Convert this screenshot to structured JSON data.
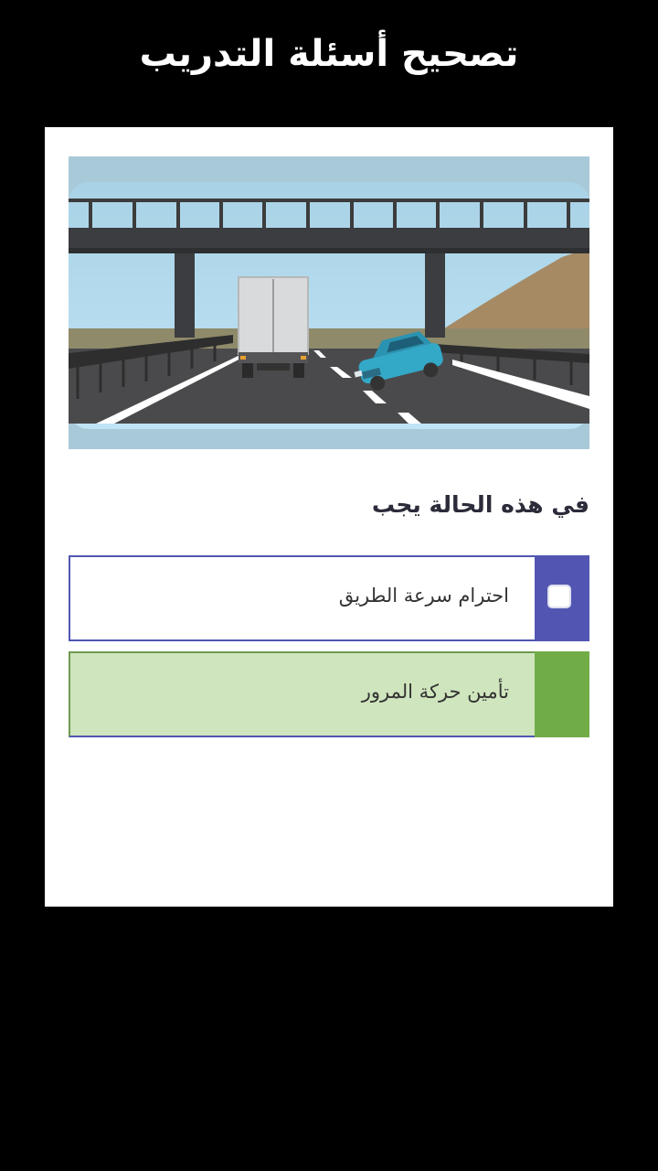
{
  "header": {
    "title": "تصحيح أسئلة التدريب"
  },
  "question": {
    "text": "في هذه الحالة يجب",
    "image_icon": "highway-accident-scene-illustration"
  },
  "options": [
    {
      "label": "احترام سرعة الطريق",
      "checked": false,
      "state": "unanswered",
      "accent": "#5256b2"
    },
    {
      "label": "تأمين حركة المرور",
      "checked": true,
      "state": "correct",
      "accent": "#71ad47",
      "fill": "#cfe5bd"
    }
  ],
  "colors": {
    "background": "#000000",
    "card": "#ffffff",
    "primary": "#5256b2",
    "correct": "#71ad47",
    "correct_fill": "#cfe5bd"
  }
}
